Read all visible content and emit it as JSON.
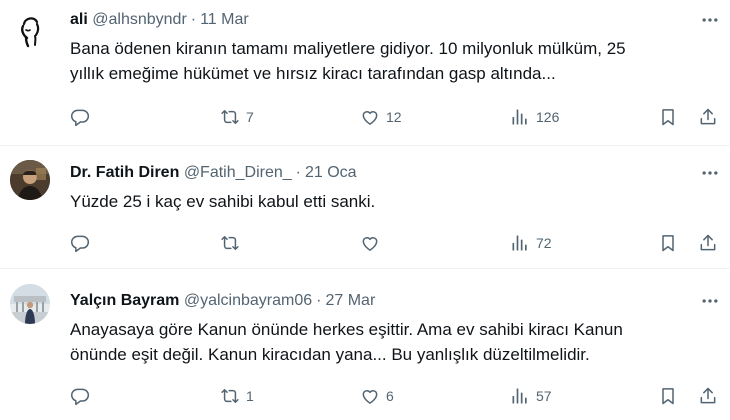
{
  "tweets": [
    {
      "name": "ali",
      "handle": "@alhsnbyndr",
      "separator": "·",
      "date": "11 Mar",
      "text_lines": [
        "Bana ödenen kiranın tamamı maliyetlere gidiyor. 10 milyonluk mülküm, 25",
        "yıllık emeğime hükümet ve hırsız kiracı tarafından gasp altında..."
      ],
      "replies": "",
      "retweets": "7",
      "likes": "12",
      "views": "126",
      "avatar": "sketch-face-avatar"
    },
    {
      "name": "Dr. Fatih Diren",
      "handle": "@Fatih_Diren_",
      "separator": "·",
      "date": "21 Oca",
      "text_lines": [
        "Yüzde 25 i kaç ev sahibi kabul etti sanki."
      ],
      "replies": "",
      "retweets": "",
      "likes": "",
      "views": "72",
      "avatar": "photo-avatar"
    },
    {
      "name": "Yalçın Bayram",
      "handle": "@yalcinbayram06",
      "separator": "·",
      "date": "27 Mar",
      "text_lines": [
        "Anayasaya göre Kanun önünde herkes eşittir. Ama ev sahibi kiracı Kanun",
        "önünde eşit değil. Kanun kiracıdan yana... Bu yanlışlık düzeltilmelidir."
      ],
      "replies": "",
      "retweets": "1",
      "likes": "6",
      "views": "57",
      "avatar": "monument-photo-avatar"
    }
  ],
  "icons": {
    "reply": "reply-icon",
    "retweet": "retweet-icon",
    "like": "heart-icon",
    "views": "views-icon",
    "bookmark": "bookmark-icon",
    "share": "share-icon",
    "more": "more-icon"
  },
  "colors": {
    "text": "#0f1419",
    "muted": "#536471",
    "divider": "#eff3f4"
  }
}
